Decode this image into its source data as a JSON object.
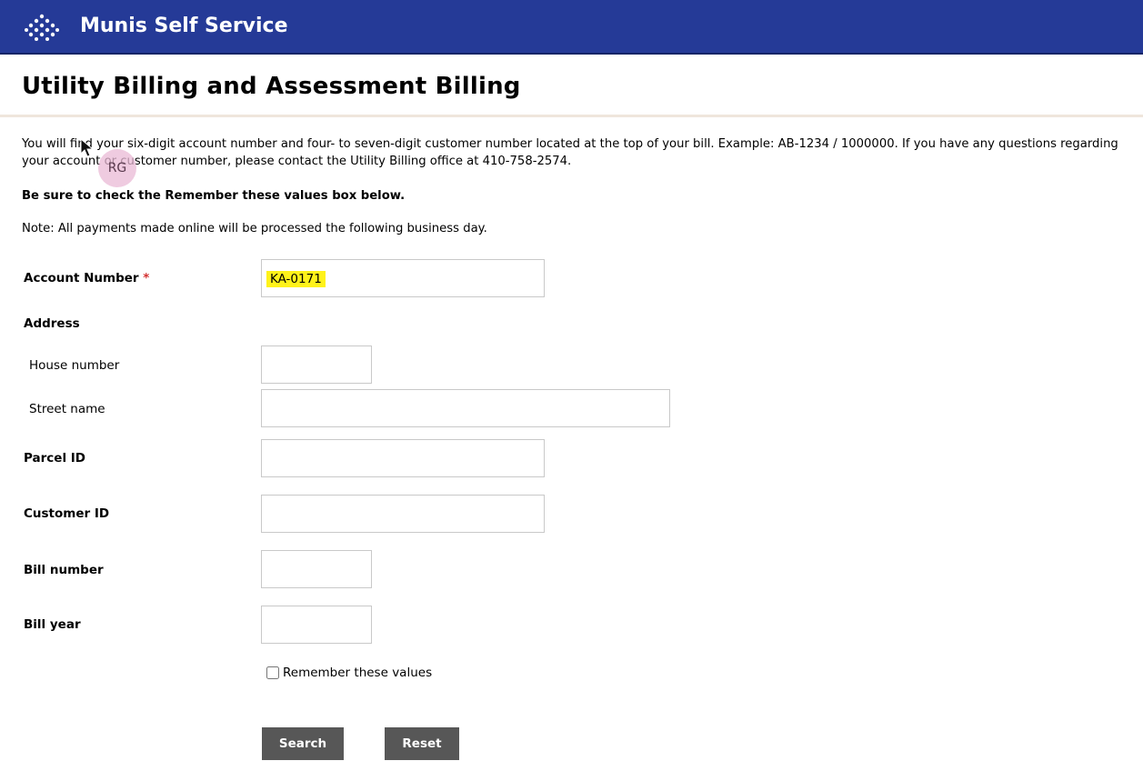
{
  "header": {
    "app_title": "Munis Self Service",
    "logo_icon": "dots-diamond-icon",
    "bg_color": "#253a97"
  },
  "page": {
    "title": "Utility Billing and Assessment Billing",
    "intro": "You will find your six-digit account number and four- to seven-digit customer number located at the top of your bill. Example: AB-1234 / 1000000. If you have any questions regarding your account or customer number, please contact the Utility Billing office at 410-758-2574.",
    "remember_note": "Be sure to check the Remember these values box below.",
    "payment_note": "Note: All payments made online will be processed the following business day."
  },
  "form": {
    "account_number": {
      "label": "Account Number",
      "required_mark": "*",
      "value": "KA-0171"
    },
    "address": {
      "label": "Address",
      "house_number": {
        "label": "House number",
        "value": ""
      },
      "street_name": {
        "label": "Street name",
        "value": ""
      }
    },
    "parcel_id": {
      "label": "Parcel ID",
      "value": ""
    },
    "customer_id": {
      "label": "Customer ID",
      "value": ""
    },
    "bill_number": {
      "label": "Bill number",
      "value": ""
    },
    "bill_year": {
      "label": "Bill year",
      "value": ""
    },
    "remember": {
      "label": "Remember these values",
      "checked": false
    },
    "search_label": "Search",
    "reset_label": "Reset"
  },
  "overlay": {
    "avatar_initials": "RG",
    "cursor_icon": "mouse-pointer-icon"
  }
}
